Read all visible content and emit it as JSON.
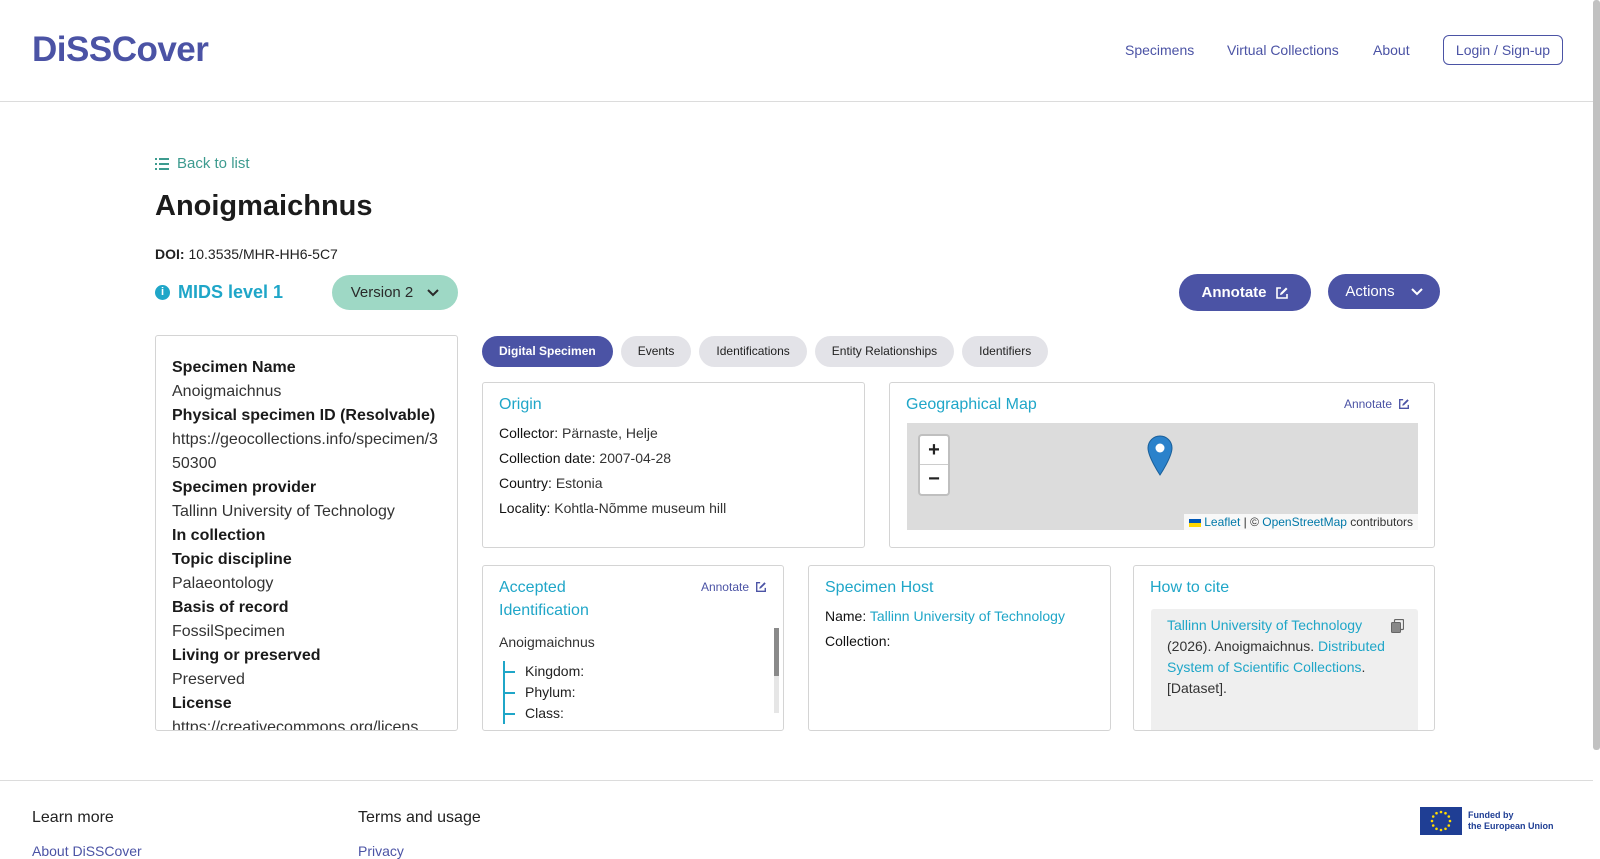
{
  "header": {
    "logo": "DiSSCover",
    "nav": [
      "Specimens",
      "Virtual Collections",
      "About"
    ],
    "login": "Login / Sign-up"
  },
  "page": {
    "back_label": "Back to list",
    "title": "Anoigmaichnus",
    "doi_label": "DOI:",
    "doi_value": "10.3535/MHR-HH6-5C7",
    "mids_label": "MIDS level 1",
    "version_label": "Version 2",
    "annotate_label": "Annotate",
    "actions_label": "Actions"
  },
  "sidepanel": {
    "fields": [
      {
        "label": "Specimen Name",
        "value": "Anoigmaichnus"
      },
      {
        "label": "Physical specimen ID (Resolvable)",
        "value": "https://geocollections.info/specimen/350300"
      },
      {
        "label": "Specimen provider",
        "value": "Tallinn University of Technology"
      },
      {
        "label": "In collection",
        "value": ""
      },
      {
        "label": "Topic discipline",
        "value": "Palaeontology"
      },
      {
        "label": "Basis of record",
        "value": "FossilSpecimen"
      },
      {
        "label": "Living or preserved",
        "value": "Preserved"
      },
      {
        "label": "License",
        "value": "https://creativecommons.org/licens"
      }
    ]
  },
  "tabs": [
    "Digital Specimen",
    "Events",
    "Identifications",
    "Entity Relationships",
    "Identifiers"
  ],
  "origin": {
    "title": "Origin",
    "rows": [
      {
        "label": "Collector:",
        "value": "Pärnaste, Helje"
      },
      {
        "label": "Collection date:",
        "value": "2007-04-28"
      },
      {
        "label": "Country:",
        "value": "Estonia"
      },
      {
        "label": "Locality:",
        "value": "Kohtla-Nõmme museum hill"
      }
    ]
  },
  "geomap": {
    "title": "Geographical Map",
    "annotate": "Annotate",
    "zoom_in": "+",
    "zoom_out": "−",
    "attrib_leaflet": "Leaflet",
    "attrib_sep": " | © ",
    "attrib_osm": "OpenStreetMap",
    "attrib_tail": " contributors"
  },
  "accepted": {
    "title": "Accepted Identification",
    "annotate": "Annotate",
    "name": "Anoigmaichnus",
    "tree": [
      "Kingdom:",
      "Phylum:",
      "Class:"
    ]
  },
  "host": {
    "title": "Specimen Host",
    "name_label": "Name:",
    "name_value": "Tallinn University of Technology",
    "collection_label": "Collection:"
  },
  "cite": {
    "title": "How to cite",
    "link1": "Tallinn University of Technology",
    "text1": " (2026). Anoigmaichnus. ",
    "link2": "Distributed System of Scientific Collections",
    "text2": ". [Dataset]."
  },
  "footer": {
    "learn_more": "Learn more",
    "about": "About DiSSCover",
    "terms": "Terms and usage",
    "privacy": "Privacy",
    "eu_line1": "Funded by",
    "eu_line2": "the European Union"
  },
  "colors": {
    "brand": "#4b53a5",
    "accent": "#1fa6c8",
    "version_bg": "#9ed8c5"
  }
}
